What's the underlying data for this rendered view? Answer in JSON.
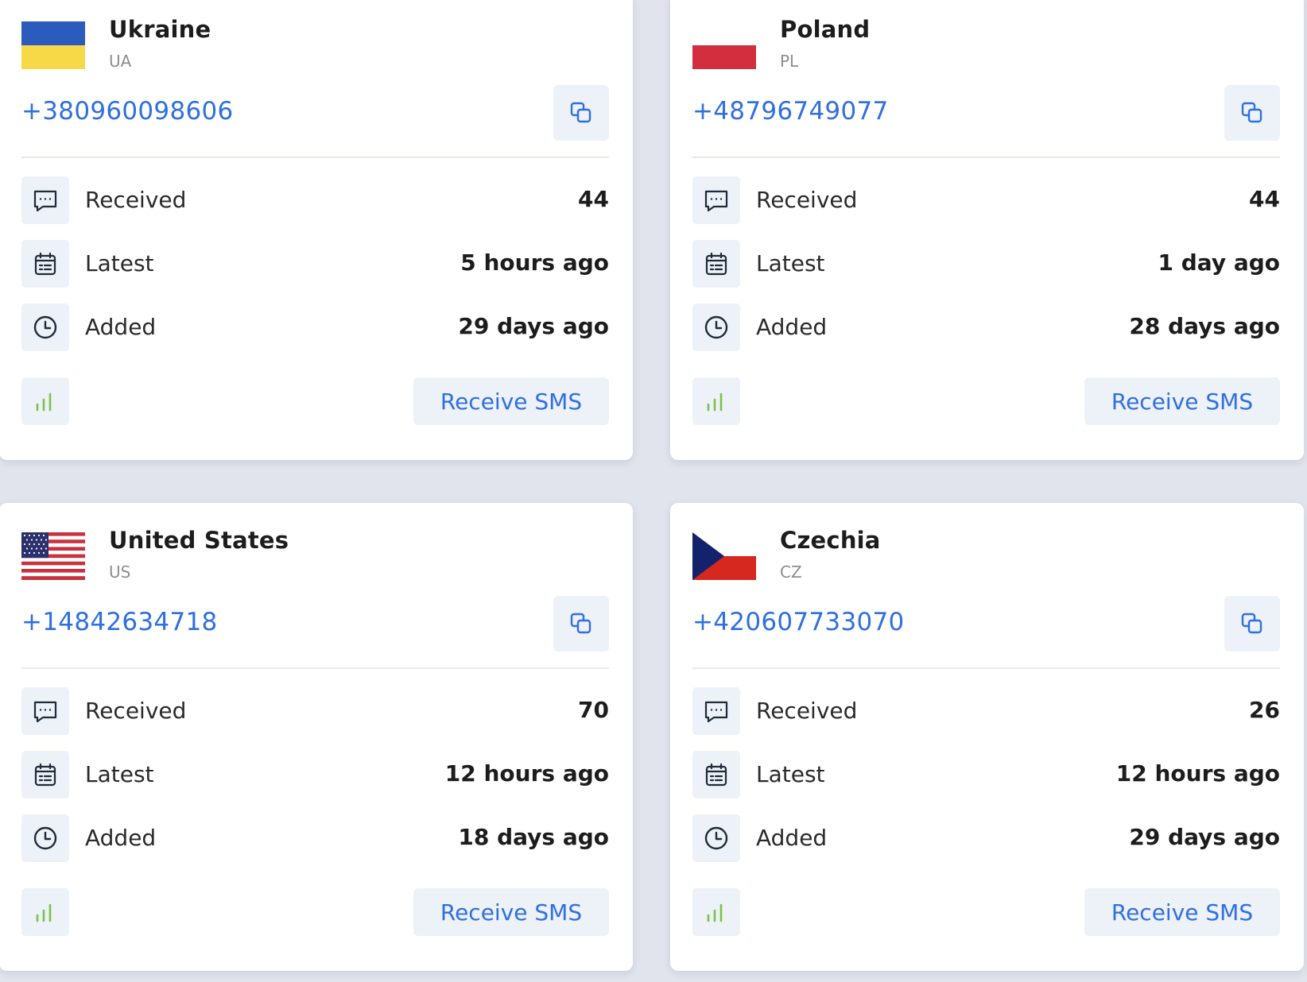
{
  "cards": [
    {
      "country": "Ukraine",
      "code": "UA",
      "flag": "ukraine-flag",
      "phone": "+380960098606",
      "stats": {
        "received_label": "Received",
        "received": "44",
        "latest_label": "Latest",
        "latest": "5 hours ago",
        "added_label": "Added",
        "added": "29 days ago"
      },
      "button": "Receive SMS"
    },
    {
      "country": "Poland",
      "code": "PL",
      "flag": "poland-flag",
      "phone": "+48796749077",
      "stats": {
        "received_label": "Received",
        "received": "44",
        "latest_label": "Latest",
        "latest": "1 day ago",
        "added_label": "Added",
        "added": "28 days ago"
      },
      "button": "Receive SMS"
    },
    {
      "country": "United States",
      "code": "US",
      "flag": "us-flag",
      "phone": "+14842634718",
      "stats": {
        "received_label": "Received",
        "received": "70",
        "latest_label": "Latest",
        "latest": "12 hours ago",
        "added_label": "Added",
        "added": "18 days ago"
      },
      "button": "Receive SMS"
    },
    {
      "country": "Czechia",
      "code": "CZ",
      "flag": "czechia-flag",
      "phone": "+420607733070",
      "stats": {
        "received_label": "Received",
        "received": "26",
        "latest_label": "Latest",
        "latest": "12 hours ago",
        "added_label": "Added",
        "added": "29 days ago"
      },
      "button": "Receive SMS"
    }
  ],
  "icons": {
    "received": "message-dots-icon",
    "latest": "calendar-icon",
    "added": "clock-icon",
    "copy": "copy-icon",
    "signal": "signal-bars-icon"
  },
  "colors": {
    "accent": "#2f6fe0",
    "signal": "#7cc24a",
    "icon_bg": "#edf1f8",
    "page_bg": "#e1e4ec"
  }
}
